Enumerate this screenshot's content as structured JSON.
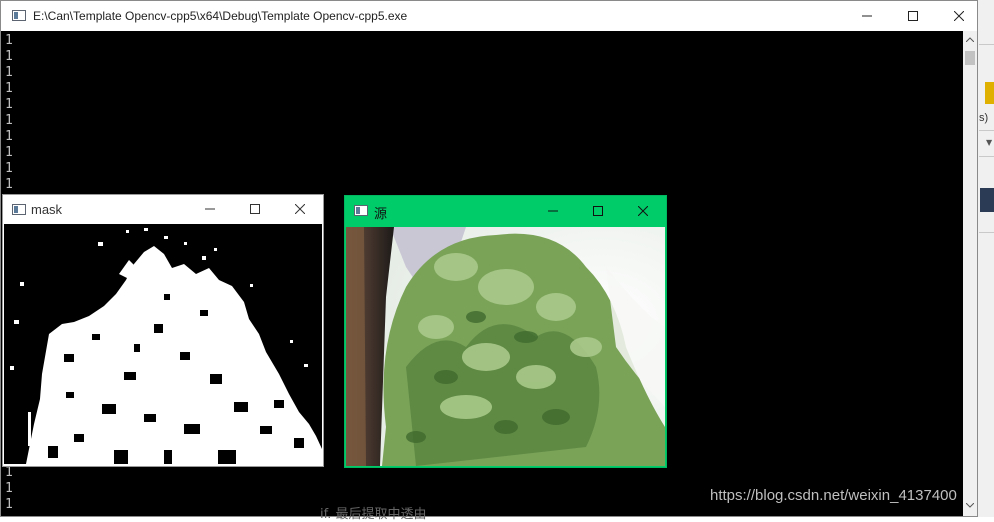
{
  "console": {
    "title": "E:\\Can\\Template Opencv-cpp5\\x64\\Debug\\Template Opencv-cpp5.exe",
    "lines": [
      "1",
      "1",
      "1",
      "1",
      "1",
      "1",
      "1",
      "1",
      "1",
      "1",
      "1"
    ],
    "bottom_lines": [
      "1",
      "1",
      "1"
    ]
  },
  "mask_window": {
    "title": "mask"
  },
  "source_window": {
    "title": "源"
  },
  "background": {
    "fragment_text": "s)",
    "bottom_text": "if. 最后提取中透由"
  },
  "watermark": "https://blog.csdn.net/weixin_4137400",
  "colors": {
    "console_bg": "#000000",
    "console_text": "#c0c0c0",
    "source_titlebar": "#00cc6a",
    "mask_titlebar": "#ffffff"
  },
  "icons": [
    "app-icon",
    "minimize-icon",
    "maximize-icon",
    "close-icon",
    "scroll-up-icon",
    "scroll-down-icon"
  ]
}
